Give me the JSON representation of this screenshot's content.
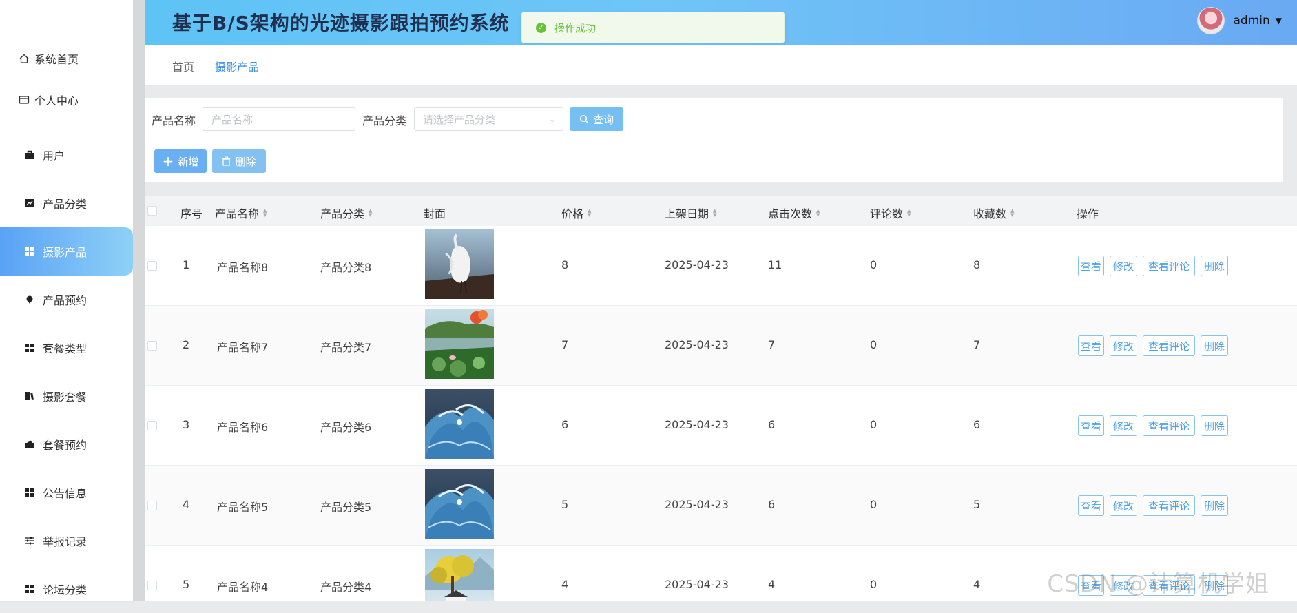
{
  "app": {
    "title": "基于B/S架构的光迹摄影跟拍预约系统"
  },
  "user": {
    "name": "admin"
  },
  "toast": {
    "message": "操作成功"
  },
  "sidebar": {
    "items": [
      {
        "label": "系统首页",
        "icon": "home-icon"
      },
      {
        "label": "个人中心",
        "icon": "id-card-icon"
      },
      {
        "label": "用户",
        "icon": "briefcase-icon"
      },
      {
        "label": "产品分类",
        "icon": "chart-icon"
      },
      {
        "label": "摄影产品",
        "icon": "grid-icon",
        "active": true
      },
      {
        "label": "产品预约",
        "icon": "pin-icon"
      },
      {
        "label": "套餐类型",
        "icon": "grid-icon"
      },
      {
        "label": "摄影套餐",
        "icon": "books-icon"
      },
      {
        "label": "套餐预约",
        "icon": "wallet-icon"
      },
      {
        "label": "公告信息",
        "icon": "grid-icon"
      },
      {
        "label": "举报记录",
        "icon": "sliders-icon"
      },
      {
        "label": "论坛分类",
        "icon": "grid-icon"
      }
    ]
  },
  "breadcrumb": {
    "home": "首页",
    "current": "摄影产品"
  },
  "search": {
    "name_label": "产品名称",
    "name_placeholder": "产品名称",
    "category_label": "产品分类",
    "category_placeholder": "请选择产品分类",
    "query_label": "查询",
    "add_label": "新增",
    "delete_label": "删除"
  },
  "table": {
    "columns": [
      "序号",
      "产品名称",
      "产品分类",
      "封面",
      "价格",
      "上架日期",
      "点击次数",
      "评论数",
      "收藏数",
      "操作"
    ],
    "actions": {
      "view": "查看",
      "edit": "修改",
      "view_comments": "查看评论",
      "delete": "删除"
    },
    "rows": [
      {
        "index": "1",
        "name": "产品名称8",
        "category": "产品分类8",
        "cover": "egret",
        "price": "8",
        "date": "2025-04-23",
        "clicks": "11",
        "comments": "0",
        "favorites": "8"
      },
      {
        "index": "2",
        "name": "产品名称7",
        "category": "产品分类7",
        "cover": "lake",
        "price": "7",
        "date": "2025-04-23",
        "clicks": "7",
        "comments": "0",
        "favorites": "7"
      },
      {
        "index": "3",
        "name": "产品名称6",
        "category": "产品分类6",
        "cover": "wave",
        "price": "6",
        "date": "2025-04-23",
        "clicks": "6",
        "comments": "0",
        "favorites": "6"
      },
      {
        "index": "4",
        "name": "产品名称5",
        "category": "产品分类5",
        "cover": "wave",
        "price": "5",
        "date": "2025-04-23",
        "clicks": "6",
        "comments": "0",
        "favorites": "5"
      },
      {
        "index": "5",
        "name": "产品名称4",
        "category": "产品分类4",
        "cover": "tree",
        "price": "4",
        "date": "2025-04-23",
        "clicks": "4",
        "comments": "0",
        "favorites": "4"
      }
    ]
  },
  "watermark": "CSDN @计算机学姐",
  "colors": {
    "accent": "#3a8ee6",
    "header_start": "#5ec3f5",
    "header_end": "#6aa9f3",
    "success": "#67c23a"
  }
}
